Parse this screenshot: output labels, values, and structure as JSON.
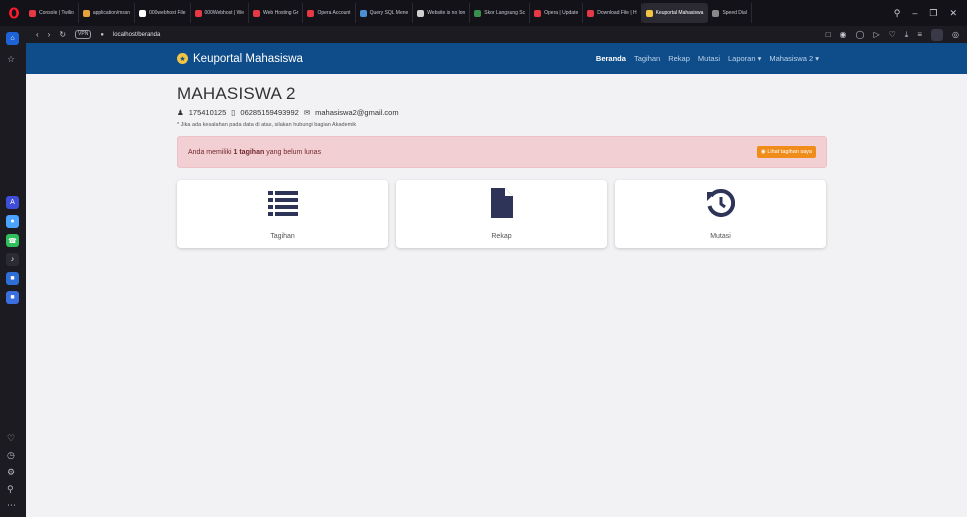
{
  "browser": {
    "tabs": [
      {
        "label": "Console | Twilio",
        "color": "#e63946"
      },
      {
        "label": "application/mssn",
        "color": "#e9a23b"
      },
      {
        "label": "000webhost File",
        "color": "#ffffff"
      },
      {
        "label": "000Webhost | We",
        "color": "#e63946"
      },
      {
        "label": "Web Hosting Gr",
        "color": "#e63946"
      },
      {
        "label": "Opera Account",
        "color": "#e63946"
      },
      {
        "label": "Query SQL Mene",
        "color": "#4a8fd6"
      },
      {
        "label": "Website is no lon",
        "color": "#cfcfcf"
      },
      {
        "label": "Skor Langsung Sc",
        "color": "#3a8f4c"
      },
      {
        "label": "Opera | Update",
        "color": "#e63946"
      },
      {
        "label": "Download File | H",
        "color": "#e63946"
      },
      {
        "label": "Keuportal Mahasiswa",
        "color": "#f4c542",
        "active": true
      },
      {
        "label": "Speed Dial",
        "color": "#888888"
      }
    ],
    "vpn_label": "VPN",
    "url": "localhost/beranda"
  },
  "navbar": {
    "brand": "Keuportal Mahasiswa",
    "links": [
      {
        "label": "Beranda",
        "active": true
      },
      {
        "label": "Tagihan"
      },
      {
        "label": "Rekap"
      },
      {
        "label": "Mutasi"
      },
      {
        "label": "Laporan ▾"
      },
      {
        "label": "Mahasiswa 2 ▾"
      }
    ]
  },
  "profile": {
    "name": "MAHASISWA 2",
    "nim": "175410125",
    "phone": "06285159493992",
    "email": "mahasiswa2@gmail.com",
    "note": "* Jika ada kesalahan pada data di atas, silakan hubungi bagian Akademik"
  },
  "alert": {
    "text_before": "Anda memiliki ",
    "highlight": "1 tagihan",
    "text_after": " yang belum lunas",
    "button": "Lihat tagihan saya",
    "button_color": "#f08c1a",
    "bg_color": "#f2cfd2"
  },
  "cards": [
    {
      "label": "Tagihan",
      "icon": "list-icon"
    },
    {
      "label": "Rekap",
      "icon": "document-icon"
    },
    {
      "label": "Mutasi",
      "icon": "history-icon"
    }
  ],
  "colors": {
    "navbar": "#0f4c8a",
    "icon": "#2d3458"
  }
}
